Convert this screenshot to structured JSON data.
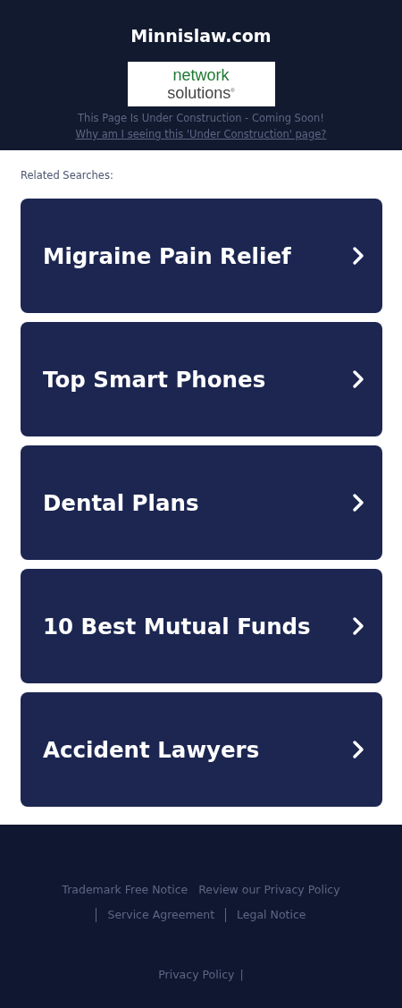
{
  "header": {
    "title": "Minnislaw.com",
    "logo": {
      "line_1": "network",
      "line_2": "solutions",
      "mark": "®"
    },
    "notice": "This Page Is Under Construction - Coming Soon!",
    "link": "Why am I seeing this 'Under Construction' page?"
  },
  "related": {
    "heading": "Related Searches:",
    "items": [
      {
        "label": "Migraine Pain Relief"
      },
      {
        "label": "Top Smart Phones"
      },
      {
        "label": "Dental Plans"
      },
      {
        "label": "10 Best Mutual Funds"
      },
      {
        "label": "Accident Lawyers"
      }
    ]
  },
  "footer": {
    "links": [
      {
        "label": "Trademark Free Notice",
        "divider_before": false
      },
      {
        "label": "Review our Privacy Policy",
        "divider_before": false
      },
      {
        "label": "Service Agreement",
        "divider_before": true
      },
      {
        "label": "Legal Notice",
        "divider_before": true
      }
    ],
    "bottom_link": "Privacy Policy",
    "bottom_separator": "|"
  }
}
